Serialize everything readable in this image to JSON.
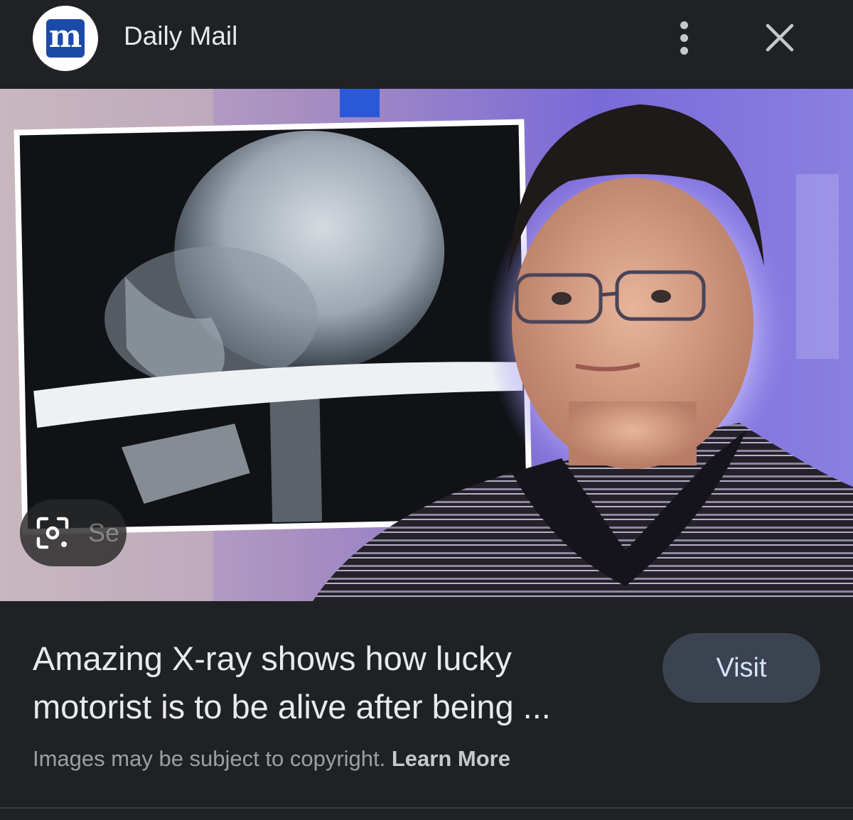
{
  "header": {
    "logo_letter": "m",
    "source_name": "Daily Mail",
    "icons": {
      "more": "more-vert-icon",
      "close": "close-icon",
      "lens": "google-lens-icon"
    }
  },
  "image": {
    "lens_label": "Se"
  },
  "caption": {
    "title": "Amazing X-ray shows how lucky motorist is to be alive after being ...",
    "visit_label": "Visit",
    "copyright_text": "Images may be subject to copyright.",
    "learn_more_label": "Learn More"
  },
  "colors": {
    "background": "#202124",
    "logo_blue": "#1c4aa8",
    "visit_bg": "#3c4350",
    "visit_text": "#d2e3fc"
  }
}
